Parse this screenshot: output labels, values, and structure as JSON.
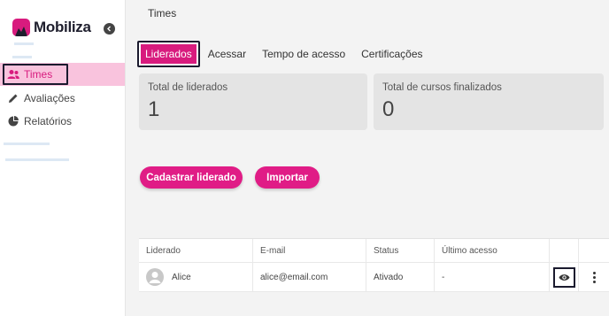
{
  "brand": {
    "name": "Mobiliza",
    "color": "#d81b7e"
  },
  "sidebar": {
    "items": [
      {
        "label": "Times",
        "icon": "users-icon",
        "active": true
      },
      {
        "label": "Avaliações",
        "icon": "pencil-icon",
        "active": false
      },
      {
        "label": "Relatórios",
        "icon": "pie-chart-icon",
        "active": false
      }
    ]
  },
  "header": {
    "title": "Times"
  },
  "tabs": [
    {
      "label": "Liderados",
      "active": true
    },
    {
      "label": "Acessar",
      "active": false
    },
    {
      "label": "Tempo de acesso",
      "active": false
    },
    {
      "label": "Certificações",
      "active": false
    }
  ],
  "stats": [
    {
      "label": "Total de liderados",
      "value": "1"
    },
    {
      "label": "Total de cursos finalizados",
      "value": "0"
    }
  ],
  "actions": {
    "register_label": "Cadastrar liderado",
    "import_label": "Importar"
  },
  "table": {
    "headers": [
      "Liderado",
      "E-mail",
      "Status",
      "Último acesso"
    ],
    "rows": [
      {
        "name": "Alice",
        "email": "alice@email.com",
        "status": "Ativado",
        "last_access": "-"
      }
    ]
  }
}
